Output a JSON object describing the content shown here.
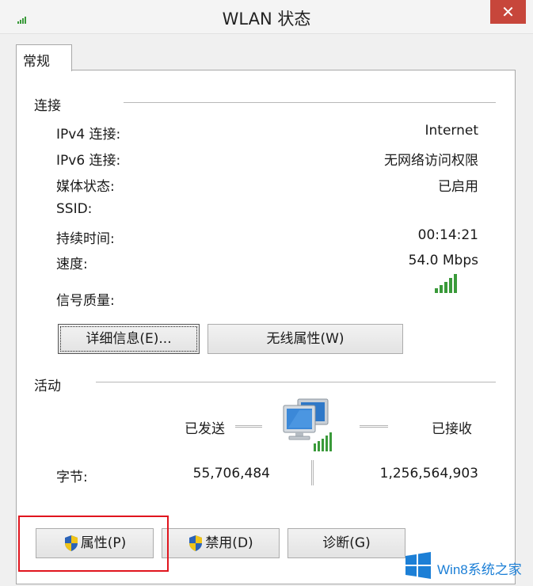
{
  "window": {
    "title": "WLAN 状态",
    "close_symbol": "✕",
    "icons": {
      "app": "wifi-signal-icon",
      "close": "close-icon"
    }
  },
  "tabs": [
    {
      "label": "常规",
      "active": true
    }
  ],
  "connection": {
    "section_label": "连接",
    "rows": [
      {
        "label": "IPv4 连接:",
        "value": "Internet"
      },
      {
        "label": "IPv6 连接:",
        "value": "无网络访问权限"
      },
      {
        "label": "媒体状态:",
        "value": "已启用"
      },
      {
        "label": "SSID:",
        "value": ""
      },
      {
        "label": "持续时间:",
        "value": "00:14:21"
      },
      {
        "label": "速度:",
        "value": "54.0 Mbps"
      },
      {
        "label": "信号质量:",
        "value": ""
      }
    ],
    "signal_icon": "signal-bars-icon",
    "details_button": "详细信息(E)...",
    "wireless_props_button": "无线属性(W)"
  },
  "activity": {
    "section_label": "活动",
    "sent_label": "已发送",
    "received_label": "已接收",
    "bytes_label": "字节:",
    "bytes_sent": "55,706,484",
    "bytes_received": "1,256,564,903",
    "network_icon": "network-computers-icon"
  },
  "footer_buttons": {
    "properties": "属性(P)",
    "disable": "禁用(D)",
    "diagnose": "诊断(G)",
    "shield_icon": "uac-shield-icon"
  },
  "watermark": {
    "text": "Win8系统之家",
    "icon": "windows-logo-icon"
  },
  "colors": {
    "close_button": "#c7463b",
    "highlight_box": "#e0151e",
    "signal_green": "#3a9a3a",
    "watermark_blue": "#1c7fd6"
  }
}
